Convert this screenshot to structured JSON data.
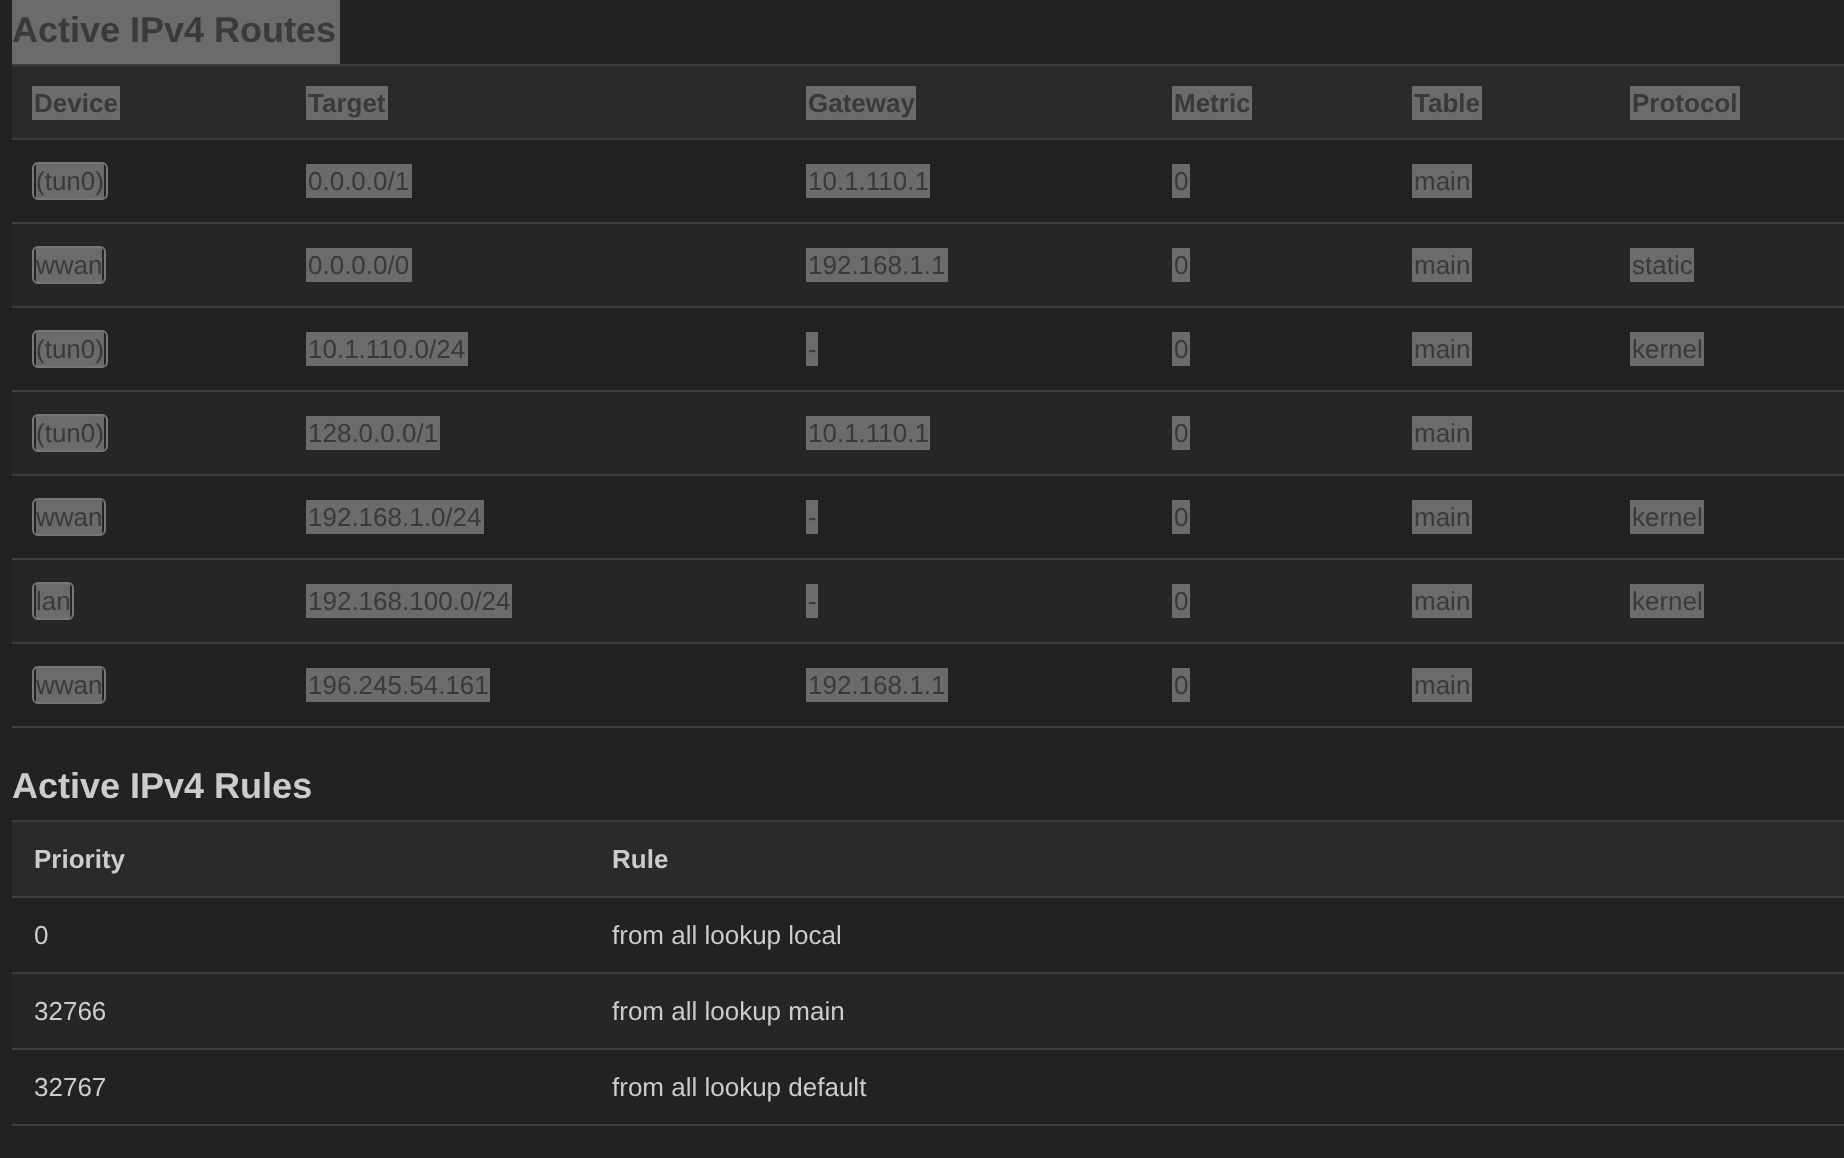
{
  "sections": [
    {
      "title": "Active IPv4 Routes",
      "selected": true,
      "table": {
        "columns": [
          "Device",
          "Target",
          "Gateway",
          "Metric",
          "Table",
          "Protocol"
        ],
        "rows": [
          {
            "device": "(tun0)",
            "target": "0.0.0.0/1",
            "gateway": "10.1.110.1",
            "metric": "0",
            "table": "main"
          },
          {
            "device": "wwan",
            "target": "0.0.0.0/0",
            "gateway": "192.168.1.1",
            "metric": "0",
            "table": "main",
            "protocol": "static"
          },
          {
            "device": "(tun0)",
            "target": "10.1.110.0/24",
            "gateway": "-",
            "metric": "0",
            "table": "main",
            "protocol": "kernel"
          },
          {
            "device": "(tun0)",
            "target": "128.0.0.0/1",
            "gateway": "10.1.110.1",
            "metric": "0",
            "table": "main"
          },
          {
            "device": "wwan",
            "target": "192.168.1.0/24",
            "gateway": "-",
            "metric": "0",
            "table": "main",
            "protocol": "kernel"
          },
          {
            "device": "lan",
            "target": "192.168.100.0/24",
            "gateway": "-",
            "metric": "0",
            "table": "main",
            "protocol": "kernel"
          },
          {
            "device": "wwan",
            "target": "196.245.54.161",
            "gateway": "192.168.1.1",
            "metric": "0",
            "table": "main"
          }
        ]
      }
    },
    {
      "title": "Active IPv4 Rules",
      "selected": false,
      "table": {
        "columns": [
          "Priority",
          "Rule"
        ],
        "rows": [
          {
            "priority": "0",
            "rule": "from all lookup local"
          },
          {
            "priority": "32766",
            "rule": "from all lookup main"
          },
          {
            "priority": "32767",
            "rule": "from all lookup default"
          }
        ]
      }
    }
  ]
}
